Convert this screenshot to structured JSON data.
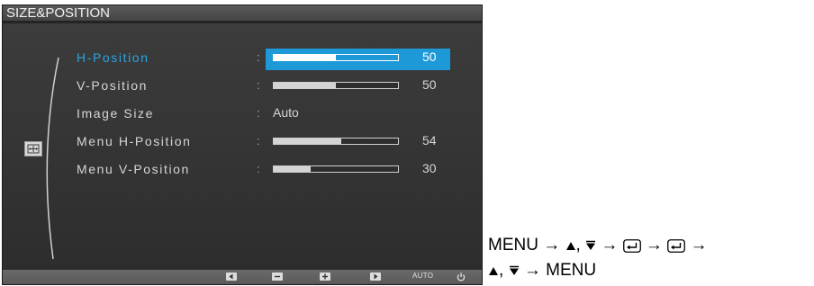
{
  "osd": {
    "title": "SIZE&POSITION",
    "items": [
      {
        "label": "H-Position",
        "value": "50",
        "level": 0.5,
        "active": true
      },
      {
        "label": "V-Position",
        "value": "50",
        "level": 0.5,
        "active": false
      },
      {
        "label": "Image Size",
        "value": "Auto",
        "active": false
      },
      {
        "label": "Menu H-Position",
        "value": "54",
        "level": 0.54,
        "active": false
      },
      {
        "label": "Menu V-Position",
        "value": "30",
        "level": 0.3,
        "active": false
      }
    ],
    "colon": ":",
    "bottom": {
      "auto_label": "AUTO"
    },
    "colors": {
      "accent": "#1d99d8",
      "active_text": "#2aa4e2",
      "panel": "#353535"
    }
  },
  "navigation": {
    "line1": {
      "start": "MENU",
      "arrow": "→",
      "sep": ","
    },
    "line2": {
      "sep": ",",
      "arrow": "→",
      "end": "MENU"
    }
  }
}
